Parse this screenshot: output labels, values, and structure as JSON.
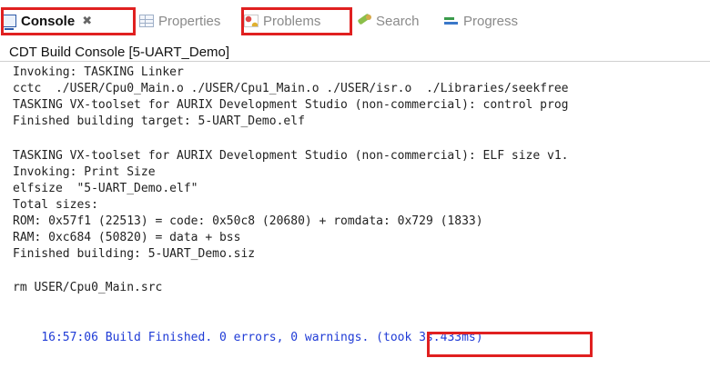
{
  "tabs": {
    "console": {
      "label": "Console",
      "close": "✖",
      "icon": "console-icon"
    },
    "properties": {
      "label": "Properties",
      "icon": "properties-icon"
    },
    "problems": {
      "label": "Problems",
      "icon": "problems-icon"
    },
    "search": {
      "label": "Search",
      "icon": "search-icon"
    },
    "progress": {
      "label": "Progress",
      "icon": "progress-icon"
    }
  },
  "console_title": "CDT Build Console [5-UART_Demo]",
  "lines": [
    "Invoking: TASKING Linker",
    "cctc  ./USER/Cpu0_Main.o ./USER/Cpu1_Main.o ./USER/isr.o  ./Libraries/seekfree",
    "TASKING VX-toolset for AURIX Development Studio (non-commercial): control prog",
    "Finished building target: 5-UART_Demo.elf",
    "",
    "TASKING VX-toolset for AURIX Development Studio (non-commercial): ELF size v1.",
    "Invoking: Print Size",
    "elfsize  \"5-UART_Demo.elf\"",
    "Total sizes:",
    "ROM: 0x57f1 (22513) = code: 0x50c8 (20680) + romdata: 0x729 (1833)",
    "RAM: 0xc684 (50820) = data + bss",
    "Finished building: 5-UART_Demo.siz",
    "",
    "rm USER/Cpu0_Main.src",
    ""
  ],
  "final_line": "16:57:06 Build Finished. 0 errors, 0 warnings. ",
  "final_took": "(took 3s.433ms)",
  "colors": {
    "highlight": "#e02020",
    "build_finished": "#1f3bd6"
  }
}
